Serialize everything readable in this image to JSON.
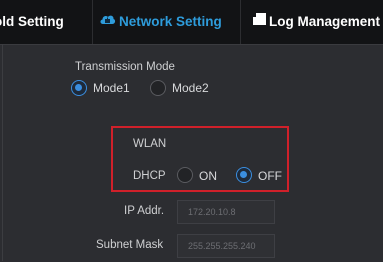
{
  "tabs": [
    {
      "label": "old Setting",
      "active": false
    },
    {
      "label": "Network Setting",
      "active": true,
      "icon": "network-cloud-icon"
    },
    {
      "label": "Log Management",
      "active": false,
      "icon": "log-icon"
    }
  ],
  "transmission": {
    "title": "Transmission Mode",
    "options": [
      {
        "label": "Mode1",
        "checked": true
      },
      {
        "label": "Mode2",
        "checked": false
      }
    ]
  },
  "wlan": {
    "title": "WLAN",
    "dhcp_label": "DHCP",
    "options": [
      {
        "label": "ON",
        "checked": false
      },
      {
        "label": "OFF",
        "checked": true
      }
    ]
  },
  "ip": {
    "label": "IP Addr.",
    "value": "172.20.10.8"
  },
  "subnet": {
    "label": "Subnet Mask",
    "value": "255.255.255.240"
  },
  "colors": {
    "accent": "#2e9cdb",
    "highlight_border": "#d0202a",
    "radio_checked": "#3a8ee0"
  }
}
